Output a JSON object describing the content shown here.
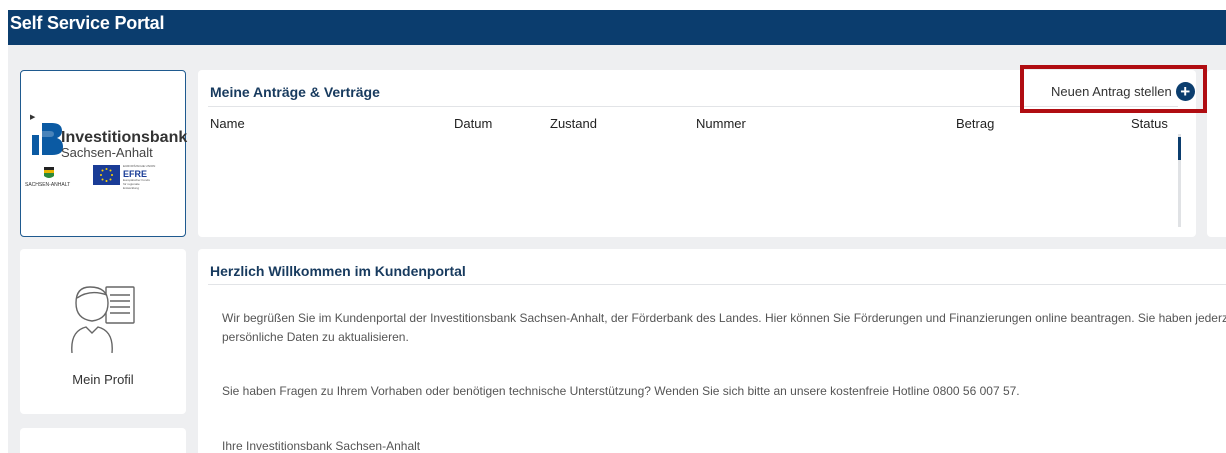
{
  "header": {
    "title": "Self Service Portal",
    "bg_color": "#0b3d6e"
  },
  "logo": {
    "name": "Investitionsbank",
    "subname": "Sachsen-Anhalt",
    "state_label": "SACHSEN-ANHALT",
    "eu_label": "EUROPÄISCHE UNION",
    "efre": "EFRE",
    "efre_sub": "Europäischer Fonds für regionale Entwicklung"
  },
  "profile": {
    "label": "Mein Profil",
    "icon": "user-profile-icon"
  },
  "contracts": {
    "title": "Meine Anträge & Verträge",
    "new_application": "Neuen Antrag stellen",
    "columns": [
      "Name",
      "Datum",
      "Zustand",
      "Nummer",
      "Betrag",
      "Status"
    ]
  },
  "welcome": {
    "title": "Herzlich Willkommen im Kundenportal",
    "paragraph1_line1": "Wir begrüßen Sie im Kundenportal der Investitionsbank Sachsen-Anhalt, der Förderbank des Landes. Hier können Sie Förderungen und Finanzierungen online beantragen. Sie haben jederzeit di",
    "paragraph1_line2": "persönliche Daten zu aktualisieren.",
    "paragraph2": "Sie haben Fragen zu Ihrem Vorhaben oder benötigen technische Unterstützung? Wenden Sie sich bitte an unsere kostenfreie Hotline 0800 56 007 57.",
    "signature": "Ihre Investitionsbank Sachsen-Anhalt"
  },
  "colors": {
    "accent": "#0b3d6e",
    "highlight": "#b00d12",
    "background": "#eeeff1"
  }
}
